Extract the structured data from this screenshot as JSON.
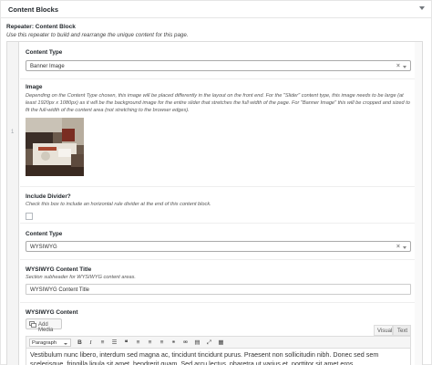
{
  "panel": {
    "title": "Content Blocks"
  },
  "repeater": {
    "label": "Repeater: Content Block",
    "description": "Use this repeater to build and rearrange the unique content for this page.",
    "row_number": "1"
  },
  "block1": {
    "content_type_label": "Content Type",
    "content_type_value": "Banner Image",
    "image_label": "Image",
    "image_description": "Depending on the Content Type chosen, this image will be placed differently in the layout on the front end. For the \"Slider\" content type, this image needs to be large (at least 1920px x 1080px) as it will be the background image for the entire slider that stretches the full width of the page. For \"Banner Image\" this will be cropped and sized to fit the full-width of the content area (not stretching to the browser edges).",
    "divider_label": "Include Divider?",
    "divider_description": "Check this box to include an horizontal rule divider at the end of this content block.",
    "divider_checked": false
  },
  "block2": {
    "content_type_label": "Content Type",
    "content_type_value": "WYSIWYG",
    "title_label": "WYSIWYG Content Title",
    "title_description": "Section subheader for WYSIWYG content areas.",
    "title_value": "WYSIWYG Content Title",
    "content_label": "WYSIWYG Content",
    "add_media_label": "Add Media",
    "tab_visual": "Visual",
    "tab_text": "Text",
    "format_value": "Paragraph",
    "toolbar_icons": [
      "bold-icon",
      "italic-icon",
      "bullet-list-icon",
      "numbered-list-icon",
      "blockquote-icon",
      "align-left-icon",
      "align-center-icon",
      "align-right-icon",
      "link-icon",
      "unlink-icon",
      "read-more-icon",
      "fullscreen-icon",
      "toolbar-toggle-icon"
    ],
    "editor_text": "Vestibulum nunc libero, interdum sed magna ac, tincidunt tincidunt purus. Praesent non sollicitudin nibh. Donec sed sem scelerisque, fringilla ligula sit amet, hendrerit quam. Sed arcu lectus, pharetra ut varius et, porttitor sit amet eros."
  }
}
